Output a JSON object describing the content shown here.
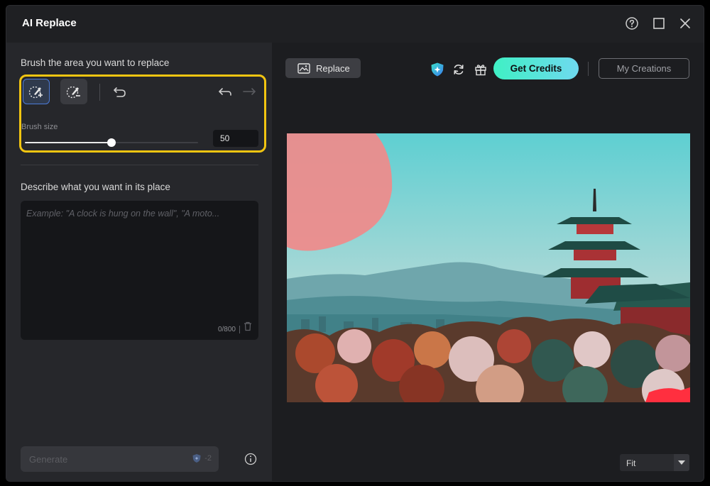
{
  "window": {
    "title": "AI Replace"
  },
  "left_panel": {
    "brush_heading": "Brush the area you want to replace",
    "brush_size_label": "Brush size",
    "brush_size_value": "50",
    "brush_size_fraction": 0.5,
    "describe_heading": "Describe what you want in its place",
    "prompt_placeholder": "Example: \"A clock is hung on the wall\", \"A moto...",
    "char_counter": "0/800",
    "generate_label": "Generate",
    "generate_cost": "-2"
  },
  "toolbar": {
    "replace_label": "Replace",
    "get_credits_label": "Get Credits",
    "my_creations_label": "My Creations"
  },
  "canvas": {
    "zoom_option": "Fit"
  },
  "colors": {
    "accent_highlight": "#f2c511",
    "credits_gradient_start": "#3ff0c4",
    "credits_gradient_end": "#6fd9ef",
    "active_tool_border": "#4c7bd8",
    "brush_mask": "#f08a8a"
  },
  "icons": {
    "titlebar": [
      "help-icon",
      "maximize-icon",
      "close-icon"
    ],
    "tools": [
      "brush-add-icon",
      "brush-erase-icon",
      "reset-icon",
      "undo-icon",
      "redo-icon"
    ],
    "toolbar": [
      "replace-image-icon",
      "credits-shield-icon",
      "refresh-icon",
      "gift-icon"
    ]
  }
}
